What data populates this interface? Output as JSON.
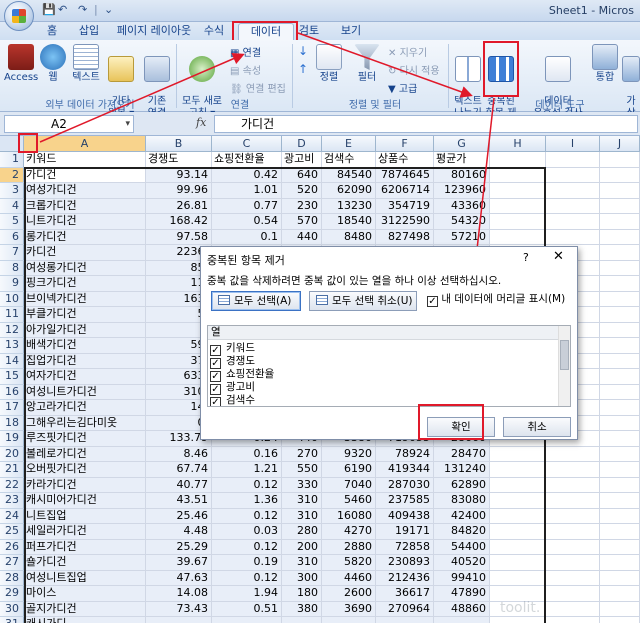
{
  "window": {
    "title": "Sheet1 - Micros"
  },
  "quick_access": {
    "undo": "↶",
    "redo": "↷",
    "sep": "|",
    "more": "⌄"
  },
  "tabs": [
    "홈",
    "삽입",
    "페이지 레이아웃",
    "수식",
    "데이터",
    "검토",
    "보기"
  ],
  "active_tab": "데이터",
  "ribbon": {
    "access": "Access",
    "web": "웹",
    "text": "텍스트",
    "other": "기타\n원본 ▾",
    "existing": "기존\n연결",
    "refresh_all": "모두 새로\n고침 ▾",
    "conn": "연결",
    "props": "속성",
    "edit_links": "연결 편집",
    "sort_asc": "↓",
    "sort_desc": "↑",
    "sort": "정렬",
    "filter": "필터",
    "clear": "지우기",
    "reapply": "다시 적용",
    "advanced": "고급",
    "text_to_cols": "텍스트\n나누기",
    "remove_dup": "중복된\n항목 제거",
    "validation": "데이터\n유효성 검사 ▾",
    "consolidate": "통합",
    "whatif": "가상\n분석 ▾",
    "group_external": "외부 데이터 가져오기",
    "group_conn": "연결",
    "group_sortfilter": "정렬 및 필터",
    "group_tools": "데이터 도구"
  },
  "formula_bar": {
    "name_box": "A2",
    "dropdown": "▾",
    "fx": "fx",
    "value": "가디건"
  },
  "columns": [
    "A",
    "B",
    "C",
    "D",
    "E",
    "F",
    "G",
    "H",
    "I",
    "J"
  ],
  "rows": [
    [
      "1",
      "키워드",
      "경쟁도",
      "쇼핑전환율",
      "광고비",
      "검색수",
      "상품수",
      "평균가"
    ],
    [
      "2",
      "가디건",
      "93.14",
      "0.42",
      "640",
      "84540",
      "7874645",
      "80160"
    ],
    [
      "3",
      "여성가디건",
      "99.96",
      "1.01",
      "520",
      "62090",
      "6206714",
      "123960"
    ],
    [
      "4",
      "크롭가디건",
      "26.81",
      "0.77",
      "230",
      "13230",
      "354719",
      "43360"
    ],
    [
      "5",
      "니트가디건",
      "168.42",
      "0.54",
      "570",
      "18540",
      "3122590",
      "54320"
    ],
    [
      "6",
      "롱가디건",
      "97.58",
      "0.1",
      "440",
      "8480",
      "827498",
      "57210"
    ],
    [
      "7",
      "카디건",
      "2236.",
      "",
      "",
      "",
      "",
      ""
    ],
    [
      "8",
      "여성롱가디건",
      "85.",
      "",
      "",
      "",
      "",
      ""
    ],
    [
      "9",
      "핑크가디건",
      "11.",
      "",
      "",
      "",
      "",
      ""
    ],
    [
      "10",
      "브이넥가디건",
      "163.",
      "",
      "",
      "",
      "",
      ""
    ],
    [
      "11",
      "부클가디건",
      "5.",
      "",
      "",
      "",
      "",
      ""
    ],
    [
      "12",
      "아가일가디건",
      "",
      "",
      "",
      "",
      "",
      ""
    ],
    [
      "13",
      "배색가디건",
      "59.",
      "",
      "",
      "",
      "",
      ""
    ],
    [
      "14",
      "집업가디건",
      "37.",
      "",
      "",
      "",
      "",
      ""
    ],
    [
      "15",
      "여자가디건",
      "633.",
      "",
      "",
      "",
      "",
      ""
    ],
    [
      "16",
      "여성니트가디건",
      "310.",
      "",
      "",
      "",
      "",
      ""
    ],
    [
      "17",
      "앙고라가디건",
      "14.",
      "",
      "",
      "",
      "",
      ""
    ],
    [
      "18",
      "그해우리는김다미옷",
      "0.",
      "",
      "",
      "",
      "",
      ""
    ],
    [
      "19",
      "루즈핏가디건",
      "133.79",
      "0.24",
      "440",
      "3380",
      "719055",
      "28660"
    ],
    [
      "20",
      "볼레로가디건",
      "8.46",
      "0.16",
      "270",
      "9320",
      "78924",
      "28470"
    ],
    [
      "21",
      "오버핏가디건",
      "67.74",
      "1.21",
      "550",
      "6190",
      "419344",
      "131240"
    ],
    [
      "22",
      "카라가디건",
      "40.77",
      "0.12",
      "330",
      "7040",
      "287030",
      "62890"
    ],
    [
      "23",
      "캐시미어가디건",
      "43.51",
      "1.36",
      "310",
      "5460",
      "237585",
      "83080"
    ],
    [
      "24",
      "니트집업",
      "25.46",
      "0.12",
      "310",
      "16080",
      "409438",
      "42400"
    ],
    [
      "25",
      "세일러가디건",
      "4.48",
      "0.03",
      "280",
      "4270",
      "19171",
      "84820"
    ],
    [
      "26",
      "퍼프가디건",
      "25.29",
      "0.12",
      "200",
      "2880",
      "72858",
      "54400"
    ],
    [
      "27",
      "숄가디건",
      "39.67",
      "0.19",
      "310",
      "5820",
      "230893",
      "40520"
    ],
    [
      "28",
      "여성니트집업",
      "47.63",
      "0.12",
      "300",
      "4460",
      "212436",
      "99410"
    ],
    [
      "29",
      "마이스",
      "14.08",
      "1.94",
      "180",
      "2600",
      "36617",
      "47890"
    ],
    [
      "30",
      "골지가디건",
      "73.43",
      "0.51",
      "380",
      "3690",
      "270964",
      "48860"
    ],
    [
      "31",
      "캐시가디",
      "",
      "",
      "",
      "",
      "",
      ""
    ]
  ],
  "dialog": {
    "title": "중복된 항목 제거",
    "help": "?",
    "close": "✕",
    "message": "중복 값을 삭제하려면 중복 값이 있는 열을 하나 이상 선택하십시오.",
    "select_all": "모두 선택(A)",
    "unselect_all": "모두 선택 취소(U)",
    "header_check": "내 데이터에 머리글 표시(M)",
    "check_mark": "✓",
    "list_header": "열",
    "columns": [
      "키워드",
      "경쟁도",
      "쇼핑전환율",
      "광고비",
      "검색수"
    ],
    "ok": "확인",
    "cancel": "취소"
  },
  "watermark": "toolit."
}
